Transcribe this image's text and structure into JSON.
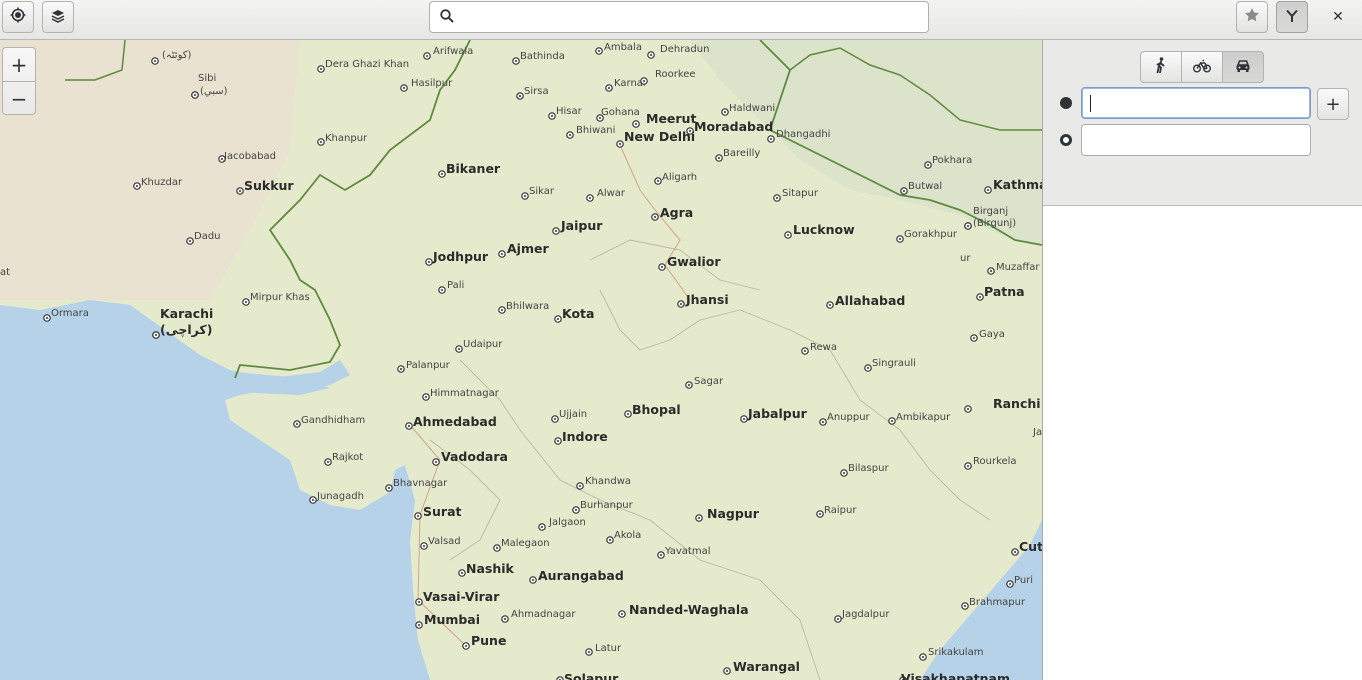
{
  "header": {
    "search_value": "",
    "close_label": "✕"
  },
  "zoom": {
    "in_label": "+",
    "out_label": "−"
  },
  "route": {
    "modes": [
      {
        "name": "walking",
        "icon": "walk-icon"
      },
      {
        "name": "cycling",
        "icon": "bike-icon"
      },
      {
        "name": "driving",
        "icon": "car-icon",
        "selected": true
      }
    ],
    "start_value": "",
    "end_value": "",
    "add_label": "+"
  },
  "colors": {
    "land": "#e6eacd",
    "water": "#b5d0e6",
    "border": "#5e8a3e"
  },
  "map": {
    "cities": [
      {
        "name": "(كوئٹہ)",
        "big": false
      },
      {
        "name": "Sibi",
        "big": false
      },
      {
        "name": "(سبي)",
        "big": false
      },
      {
        "name": "Jacobabad",
        "big": false
      },
      {
        "name": "Khuzdar",
        "big": false
      },
      {
        "name": "Sukkur",
        "big": true
      },
      {
        "name": "Dadu",
        "big": false
      },
      {
        "name": "Mirpur Khas",
        "big": false
      },
      {
        "name": "Karachi",
        "big": true
      },
      {
        "name": "(کراچی)",
        "big": true
      },
      {
        "name": "Ormara",
        "big": false
      },
      {
        "name": "at",
        "big": false
      },
      {
        "name": "Dera Ghazi Khan",
        "big": false
      },
      {
        "name": "Hasilpur",
        "big": false
      },
      {
        "name": "Khanpur",
        "big": false
      },
      {
        "name": "Arifwala",
        "big": false
      },
      {
        "name": "Bathinda",
        "big": false
      },
      {
        "name": "Ambala",
        "big": false
      },
      {
        "name": "Dehradun",
        "big": false
      },
      {
        "name": "Sirsa",
        "big": false
      },
      {
        "name": "Karnal",
        "big": false
      },
      {
        "name": "Roorkee",
        "big": false
      },
      {
        "name": "Hisar",
        "big": false
      },
      {
        "name": "Gohana",
        "big": false
      },
      {
        "name": "Meerut",
        "big": true
      },
      {
        "name": "Haldwani",
        "big": false
      },
      {
        "name": "Bhiwani",
        "big": false
      },
      {
        "name": "New Delhi",
        "big": true
      },
      {
        "name": "Moradabad",
        "big": true
      },
      {
        "name": "Dhangadhi",
        "big": false
      },
      {
        "name": "Bareilly",
        "big": false
      },
      {
        "name": "Bikaner",
        "big": true
      },
      {
        "name": "Aligarh",
        "big": false
      },
      {
        "name": "Sikar",
        "big": false
      },
      {
        "name": "Alwar",
        "big": false
      },
      {
        "name": "Agra",
        "big": true
      },
      {
        "name": "Sitapur",
        "big": false
      },
      {
        "name": "Jaipur",
        "big": true
      },
      {
        "name": "Lucknow",
        "big": true
      },
      {
        "name": "Jodhpur",
        "big": true
      },
      {
        "name": "Ajmer",
        "big": true
      },
      {
        "name": "Gwalior",
        "big": true
      },
      {
        "name": "Pali",
        "big": false
      },
      {
        "name": "Jhansi",
        "big": true
      },
      {
        "name": "Allahabad",
        "big": true
      },
      {
        "name": "Bhilwara",
        "big": false
      },
      {
        "name": "Kota",
        "big": true
      },
      {
        "name": "Udaipur",
        "big": false
      },
      {
        "name": "Rewa",
        "big": false
      },
      {
        "name": "Palanpur",
        "big": false
      },
      {
        "name": "Singrauli",
        "big": false
      },
      {
        "name": "Himmatnagar",
        "big": false
      },
      {
        "name": "Sagar",
        "big": false
      },
      {
        "name": "Gandhidham",
        "big": false
      },
      {
        "name": "Ahmedabad",
        "big": true
      },
      {
        "name": "Ujjain",
        "big": false
      },
      {
        "name": "Bhopal",
        "big": true
      },
      {
        "name": "Jabalpur",
        "big": true
      },
      {
        "name": "Anuppur",
        "big": false
      },
      {
        "name": "Ambikapur",
        "big": false
      },
      {
        "name": "Indore",
        "big": true
      },
      {
        "name": "Rajkot",
        "big": false
      },
      {
        "name": "Vadodara",
        "big": true
      },
      {
        "name": "Bilaspur",
        "big": false
      },
      {
        "name": "Khandwa",
        "big": false
      },
      {
        "name": "Junagadh",
        "big": false
      },
      {
        "name": "Bhavnagar",
        "big": false
      },
      {
        "name": "Burhanpur",
        "big": false
      },
      {
        "name": "Surat",
        "big": true
      },
      {
        "name": "Nagpur",
        "big": true
      },
      {
        "name": "Raipur",
        "big": false
      },
      {
        "name": "Jalgaon",
        "big": false
      },
      {
        "name": "Akola",
        "big": false
      },
      {
        "name": "Valsad",
        "big": false
      },
      {
        "name": "Malegaon",
        "big": false
      },
      {
        "name": "Yavatmal",
        "big": false
      },
      {
        "name": "Nashik",
        "big": true
      },
      {
        "name": "Aurangabad",
        "big": true
      },
      {
        "name": "Vasai-Virar",
        "big": true
      },
      {
        "name": "Ahmadnagar",
        "big": false
      },
      {
        "name": "Nanded-Waghala",
        "big": true
      },
      {
        "name": "Jagdalpur",
        "big": false
      },
      {
        "name": "Mumbai",
        "big": true
      },
      {
        "name": "Pune",
        "big": true
      },
      {
        "name": "Latur",
        "big": false
      },
      {
        "name": "Warangal",
        "big": true
      },
      {
        "name": "Solapur",
        "big": true
      },
      {
        "name": "Srikakulam",
        "big": false
      },
      {
        "name": "Visakhapatnam",
        "big": true
      },
      {
        "name": "Gorakhpur",
        "big": false
      },
      {
        "name": "Muzaffar",
        "big": false
      },
      {
        "name": "Patna",
        "big": true
      },
      {
        "name": "Gaya",
        "big": false
      },
      {
        "name": "Ranchi",
        "big": true
      },
      {
        "name": "Rourkela",
        "big": false
      },
      {
        "name": "Ja",
        "big": false
      },
      {
        "name": "Cutt",
        "big": true
      },
      {
        "name": "Puri",
        "big": false
      },
      {
        "name": "Brahmapur",
        "big": false
      },
      {
        "name": "Pokhara",
        "big": false
      },
      {
        "name": "Butwal",
        "big": false
      },
      {
        "name": "Kathman",
        "big": true
      },
      {
        "name": "Birganj",
        "big": false
      },
      {
        "name": "(Birgunj)",
        "big": false
      },
      {
        "name": "ur",
        "big": false
      }
    ]
  }
}
